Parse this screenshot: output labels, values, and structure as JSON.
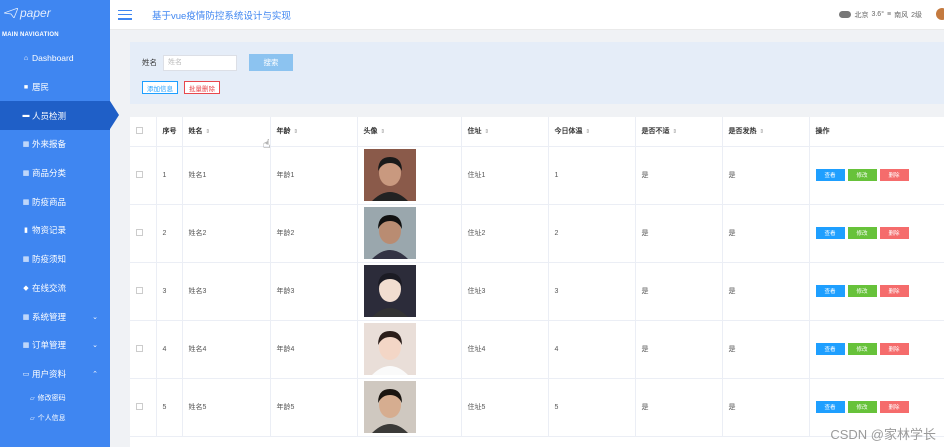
{
  "sidebar": {
    "brand": "paper",
    "nav_title": "MAIN NAVIGATION",
    "items": [
      {
        "icon": "home-icon",
        "glyph": "⌂",
        "label": "Dashboard"
      },
      {
        "icon": "comment-icon",
        "glyph": "■",
        "label": "居民"
      },
      {
        "icon": "car-icon",
        "glyph": "▬",
        "label": "人员检测",
        "active": true
      },
      {
        "icon": "grid-icon",
        "glyph": "▦",
        "label": "外来报备"
      },
      {
        "icon": "grid-icon",
        "glyph": "▦",
        "label": "商品分类"
      },
      {
        "icon": "grid-icon",
        "glyph": "▦",
        "label": "防疫商品"
      },
      {
        "icon": "file-icon",
        "glyph": "▮",
        "label": "物资记录"
      },
      {
        "icon": "grid-icon",
        "glyph": "▦",
        "label": "防疫须知"
      },
      {
        "icon": "chat-icon",
        "glyph": "◆",
        "label": "在线交流"
      },
      {
        "icon": "grid-icon",
        "glyph": "▦",
        "label": "系统管理",
        "chevron": "⌄"
      },
      {
        "icon": "grid-icon",
        "glyph": "▦",
        "label": "订单管理",
        "chevron": "⌄"
      },
      {
        "icon": "user-card-icon",
        "glyph": "▭",
        "label": "用户资料",
        "chevron": "⌃"
      }
    ],
    "sub_items": [
      {
        "icon": "folder-icon",
        "glyph": "▱",
        "label": "修改密码"
      },
      {
        "icon": "folder-icon",
        "glyph": "▱",
        "label": "个人信息"
      }
    ]
  },
  "header": {
    "title": "基于vue疫情防控系统设计与实现",
    "weather": {
      "city": "北京",
      "temp": "3.6°",
      "wind": "南风",
      "level": "2级"
    }
  },
  "search": {
    "label": "姓名",
    "placeholder": "姓名",
    "button": "搜索",
    "add_label": "添加信息",
    "batch_delete_label": "批量删除"
  },
  "table": {
    "columns": [
      "序号",
      "姓名",
      "年龄",
      "头像",
      "住址",
      "今日体温",
      "是否不适",
      "是否发热",
      "操作"
    ],
    "ops": {
      "view": "查看",
      "edit": "修改",
      "delete": "删除"
    },
    "rows": [
      {
        "no": "1",
        "name": "姓名1",
        "age": "年龄1",
        "address": "住址1",
        "temp": "1",
        "unwell": "是",
        "fever": "是"
      },
      {
        "no": "2",
        "name": "姓名2",
        "age": "年龄2",
        "address": "住址2",
        "temp": "2",
        "unwell": "是",
        "fever": "是"
      },
      {
        "no": "3",
        "name": "姓名3",
        "age": "年龄3",
        "address": "住址3",
        "temp": "3",
        "unwell": "是",
        "fever": "是"
      },
      {
        "no": "4",
        "name": "姓名4",
        "age": "年龄4",
        "address": "住址4",
        "temp": "4",
        "unwell": "是",
        "fever": "是"
      },
      {
        "no": "5",
        "name": "姓名5",
        "age": "年龄5",
        "address": "住址5",
        "temp": "5",
        "unwell": "是",
        "fever": "是"
      }
    ]
  },
  "watermark": "CSDN @家林学长",
  "colors": {
    "sidebar": "#3f86f1",
    "active": "#1f5fc7",
    "view": "#1e9fff",
    "edit": "#67c23a",
    "delete": "#f56c6c"
  }
}
